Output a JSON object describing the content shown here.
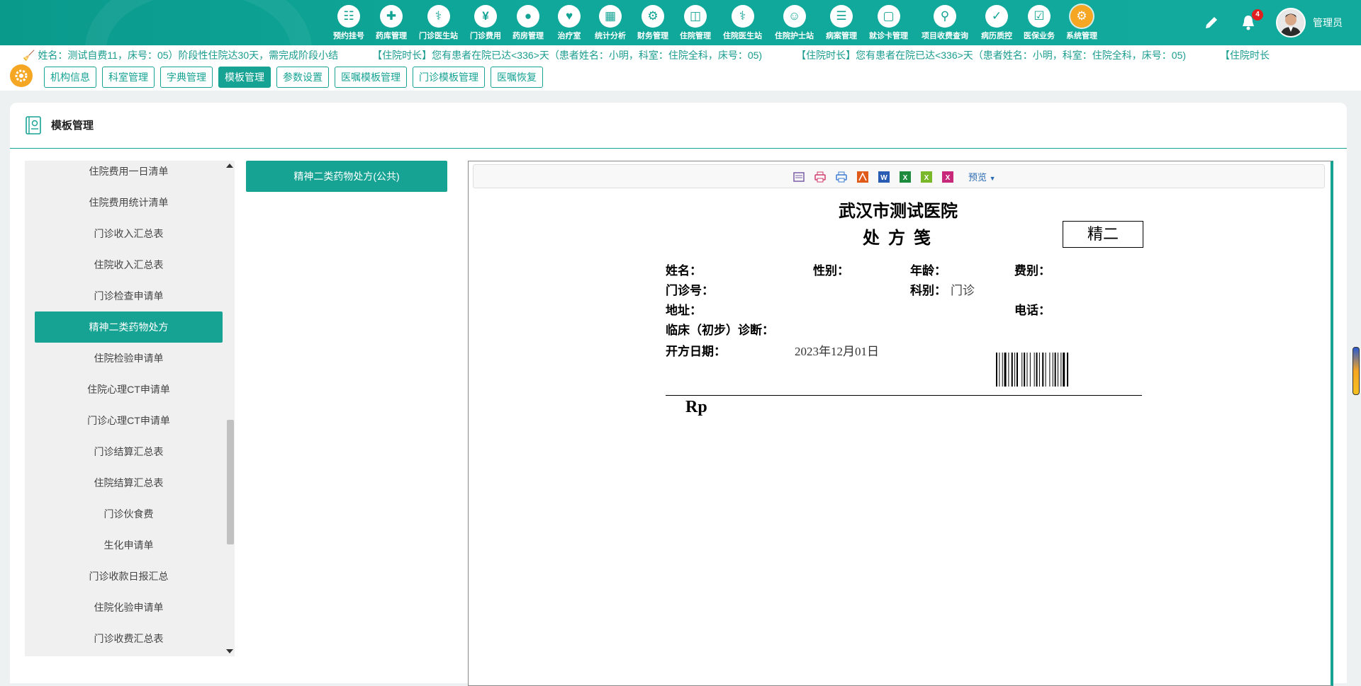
{
  "nav": {
    "items": [
      {
        "label": "预约挂号",
        "icon": "appointment-icon",
        "name": "nav-appointment"
      },
      {
        "label": "药库管理",
        "icon": "drug-store-icon",
        "name": "nav-drug-store"
      },
      {
        "label": "门诊医生站",
        "icon": "doctor-icon",
        "name": "nav-outpatient-doctor"
      },
      {
        "label": "门诊费用",
        "icon": "yuan-icon",
        "name": "nav-outpatient-fee"
      },
      {
        "label": "药房管理",
        "icon": "pill-icon",
        "name": "nav-pharmacy"
      },
      {
        "label": "治疗室",
        "icon": "nurse-icon",
        "name": "nav-treatment-room"
      },
      {
        "label": "统计分析",
        "icon": "chart-icon",
        "name": "nav-statistics"
      },
      {
        "label": "财务管理",
        "icon": "finance-gear-icon",
        "name": "nav-finance"
      },
      {
        "label": "住院管理",
        "icon": "hospital-bed-icon",
        "name": "nav-inpatient"
      },
      {
        "label": "住院医生站",
        "icon": "inpatient-doctor-icon",
        "name": "nav-inpatient-doctor"
      },
      {
        "label": "住院护士站",
        "icon": "nurse-station-icon",
        "name": "nav-nurse-station"
      },
      {
        "label": "病案管理",
        "icon": "record-icon",
        "name": "nav-medical-records"
      },
      {
        "label": "就诊卡管理",
        "icon": "card-icon",
        "name": "nav-card"
      },
      {
        "label": "项目收费查询",
        "icon": "search-doc-icon",
        "name": "nav-fee-query"
      },
      {
        "label": "病历质控",
        "icon": "quality-icon",
        "name": "nav-quality"
      },
      {
        "label": "医保业务",
        "icon": "insurance-icon",
        "name": "nav-insurance"
      },
      {
        "label": "系统管理",
        "icon": "system-gear-icon",
        "name": "nav-system",
        "active": true
      }
    ],
    "bell_count": "4",
    "user_name": "管理员"
  },
  "marquee": {
    "msg1": "姓名：测试自费11，床号：05）阶段性住院达30天，需完成阶段小结",
    "msg2": "【住院时长】您有患者在院已达<336>天（患者姓名：小明，科室：住院全科，床号：05)",
    "msg3": "【住院时长】您有患者在院已达<336>天（患者姓名：小明，科室：住院全科，床号：05)",
    "msg4": "【住院时长"
  },
  "subnav": {
    "tabs": [
      "机构信息",
      "科室管理",
      "字典管理",
      "模板管理",
      "参数设置",
      "医嘱模板管理",
      "门诊模板管理",
      "医嘱恢复"
    ],
    "active_index": 3
  },
  "panel": {
    "title": "模板管理"
  },
  "template_list": {
    "items": [
      "住院费用一日清单",
      "住院费用统计清单",
      "门诊收入汇总表",
      "住院收入汇总表",
      "门诊检查申请单",
      "精神二类药物处方",
      "住院检验申请单",
      "住院心理CT申请单",
      "门诊心理CT申请单",
      "门诊结算汇总表",
      "住院结算汇总表",
      "门诊伙食费",
      "生化申请单",
      "门诊收款日报汇总",
      "住院化验申请单",
      "门诊收费汇总表"
    ],
    "active_index": 5
  },
  "template_button": "精神二类药物处方(公共)",
  "toolbar": {
    "preview_label": "预览"
  },
  "prescription": {
    "hospital": "武汉市测试医院",
    "title": "处方笺",
    "tag": "精二",
    "name_label": "姓名：",
    "gender_label": "性别：",
    "age_label": "年龄：",
    "fee_type_label": "费别：",
    "outpatient_no_label": "门诊号：",
    "dept_label": "科别：",
    "dept_value": "门诊",
    "address_label": "地址：",
    "phone_label": "电话：",
    "diagnosis_label": "临床（初步）诊断：",
    "date_label": "开方日期：",
    "date_value": "2023年12月01日",
    "rp": "Rp"
  }
}
